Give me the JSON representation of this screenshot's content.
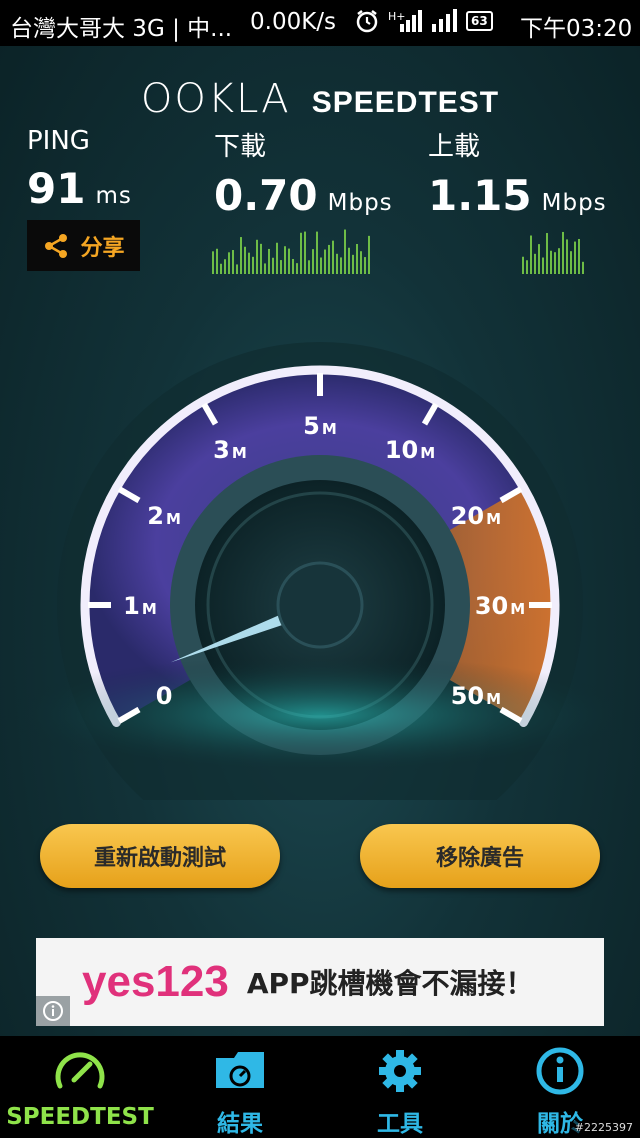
{
  "status_bar": {
    "carrier": "台灣大哥大 3G | 中...",
    "net_speed": "0.00K/s",
    "battery": "63",
    "time": "下午03:20"
  },
  "logo": {
    "ookla": "OOKLA",
    "speedtest": "SPEEDTEST"
  },
  "stats": {
    "ping": {
      "label": "PING",
      "value": "91",
      "unit": "ms"
    },
    "download": {
      "label": "下載",
      "value": "0.70",
      "unit": "Mbps"
    },
    "upload": {
      "label": "上載",
      "value": "1.15",
      "unit": "Mbps"
    }
  },
  "share": {
    "label": "分享"
  },
  "gauge": {
    "ticks": [
      {
        "num": "0",
        "unit": ""
      },
      {
        "num": "1",
        "unit": "M"
      },
      {
        "num": "2",
        "unit": "M"
      },
      {
        "num": "3",
        "unit": "M"
      },
      {
        "num": "5",
        "unit": "M"
      },
      {
        "num": "10",
        "unit": "M"
      },
      {
        "num": "20",
        "unit": "M"
      },
      {
        "num": "30",
        "unit": "M"
      },
      {
        "num": "50",
        "unit": "M"
      }
    ],
    "needle_value_mbps": 0.3,
    "colors": {
      "arc_low": "#6b4fb8",
      "arc_high": "#e07a2a",
      "needle": "#bfeeff"
    }
  },
  "buttons": {
    "restart": "重新啟動測試",
    "remove_ads": "移除廣告"
  },
  "ad": {
    "brand": "yes123",
    "text": "APP跳槽機會不漏接！"
  },
  "tabs": [
    {
      "label": "SPEEDTEST",
      "icon": "speedometer-icon",
      "active": true
    },
    {
      "label": "結果",
      "icon": "results-folder-icon",
      "active": false
    },
    {
      "label": "工具",
      "icon": "gear-icon",
      "active": false
    },
    {
      "label": "關於",
      "icon": "info-icon",
      "active": false
    }
  ],
  "watermark": "#2225397",
  "accent_colors": {
    "tab_active": "#8fe34a",
    "tab_inactive": "#2fb8e6",
    "button": "#f4b63a"
  }
}
